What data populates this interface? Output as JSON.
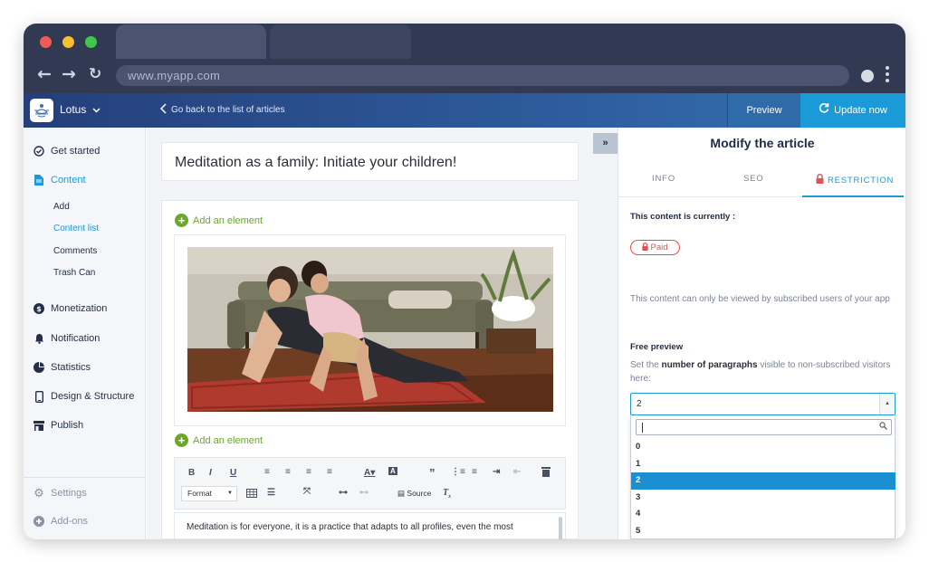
{
  "browser": {
    "url": "www.myapp.com",
    "colors": {
      "close": "#ee5c55",
      "minimize": "#f5bf2d",
      "maximize": "#3fc84a"
    }
  },
  "appbar": {
    "app_name": "Lotus",
    "back_link": "Go back to the list of articles",
    "preview_label": "Preview",
    "update_label": "Update now"
  },
  "sidebar": {
    "items": [
      {
        "label": "Get started",
        "icon": "check-circle-icon"
      },
      {
        "label": "Content",
        "icon": "document-icon"
      },
      {
        "label": "Monetization",
        "icon": "dollar-icon"
      },
      {
        "label": "Notification",
        "icon": "bell-icon"
      },
      {
        "label": "Statistics",
        "icon": "pie-chart-icon"
      },
      {
        "label": "Design & Structure",
        "icon": "phone-icon"
      },
      {
        "label": "Publish",
        "icon": "store-icon"
      }
    ],
    "content_sub": [
      "Add",
      "Content list",
      "Comments",
      "Trash Can"
    ],
    "bottom": [
      {
        "label": "Settings",
        "icon": "gear-icon"
      },
      {
        "label": "Add-ons",
        "icon": "plus-circle-icon"
      }
    ]
  },
  "editor": {
    "title": "Meditation as a family: Initiate your children!",
    "add_element": "Add an element",
    "format_label": "Format",
    "source_label": "Source",
    "body_text": "Meditation is for everyone, it is a practice that adapts to all profiles, even the most"
  },
  "panel": {
    "title": "Modify the article",
    "tabs": [
      "INFO",
      "SEO",
      "RESTRICTION"
    ],
    "status_label": "This content is currently :",
    "status_badge": "Paid",
    "status_desc": "This content can only be viewed by subscribed users of your app",
    "free_preview_label": "Free preview",
    "free_preview_pre": "Set the ",
    "free_preview_bold": "number of paragraphs",
    "free_preview_post": " visible to non-subscribed visitors here:",
    "selected_value": "2",
    "options": [
      "0",
      "1",
      "2",
      "3",
      "4",
      "5"
    ],
    "accent": "#1a9bd7",
    "badge_color": "#e25252"
  }
}
